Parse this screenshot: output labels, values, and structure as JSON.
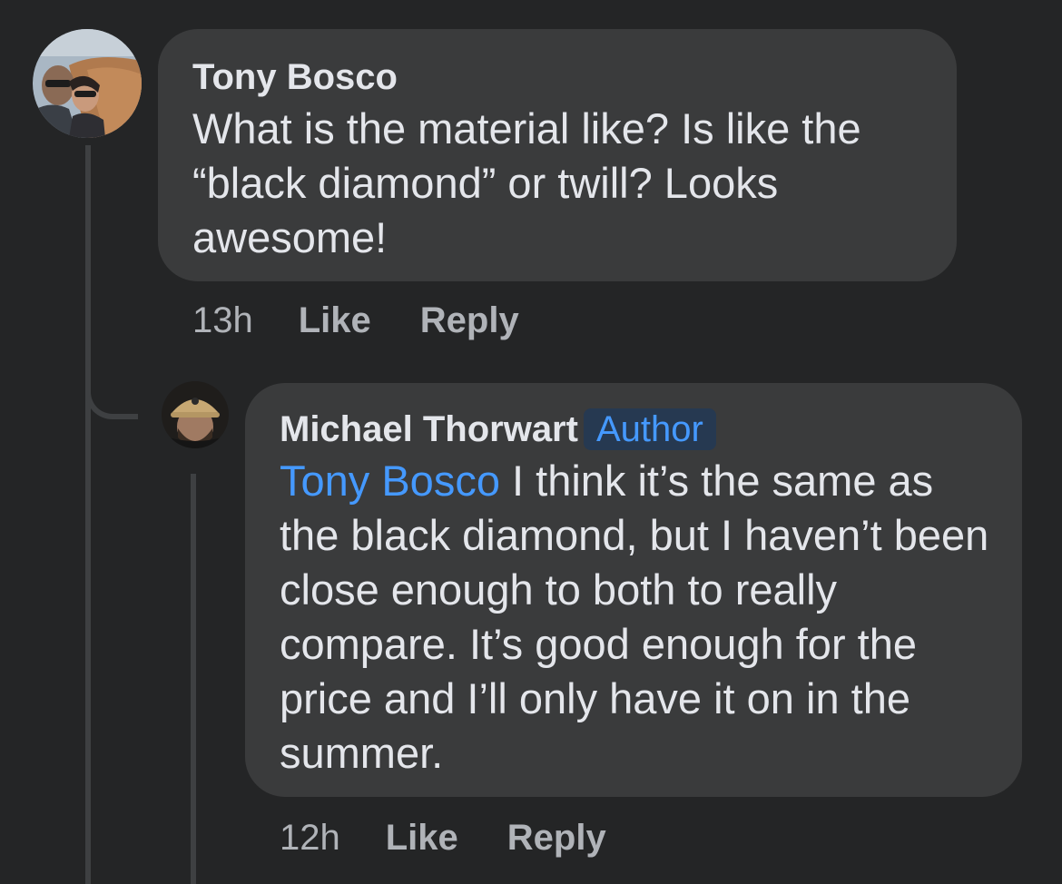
{
  "comments": [
    {
      "author": "Tony Bosco",
      "text": "What is the material like?  Is like the “black diamond” or twill?  Looks awesome!",
      "time": "13h",
      "like_label": "Like",
      "reply_label": "Reply",
      "avatar": "photo-avatar-couple-outdoors"
    }
  ],
  "replies": [
    {
      "author": "Michael Thorwart",
      "badge": "Author",
      "mention": "Tony Bosco",
      "text": " I think it’s the same as the black diamond, but I haven’t been close enough to both to really compare. It’s good enough for the price and I’ll only have it on in the summer.",
      "time": "12h",
      "like_label": "Like",
      "reply_label": "Reply",
      "avatar": "photo-avatar-man-in-cap"
    }
  ],
  "colors": {
    "background": "#242526",
    "bubble": "#3a3b3c",
    "text_primary": "#e4e6eb",
    "text_secondary": "#b0b3b8",
    "accent_blue": "#4599ff",
    "badge_bg": "#263951"
  }
}
